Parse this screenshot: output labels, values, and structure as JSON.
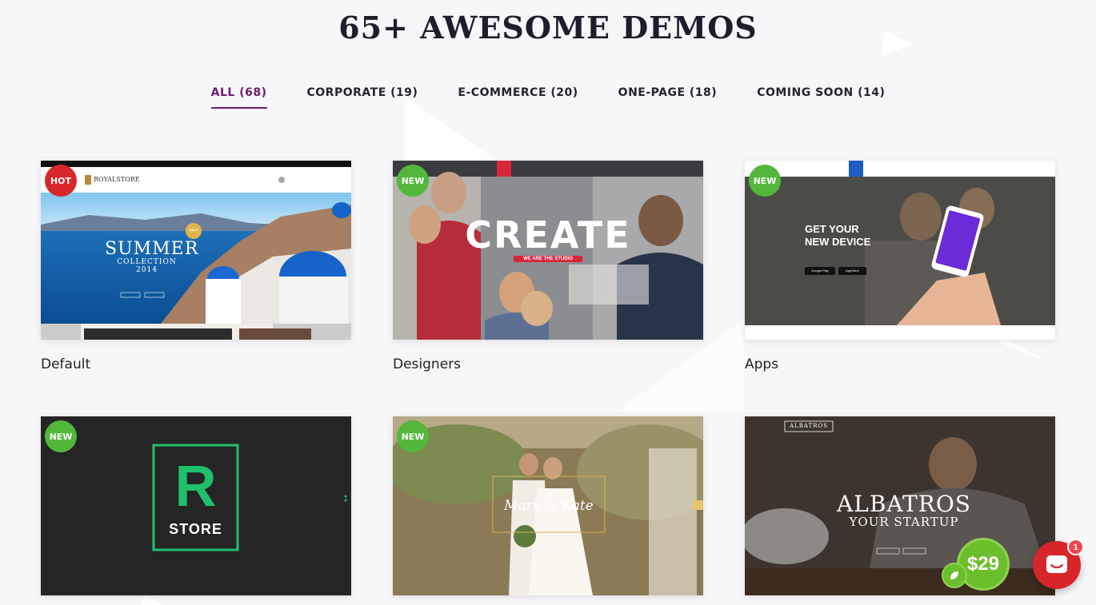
{
  "header": {
    "title": "65+ AWESOME DEMOS"
  },
  "filters": [
    {
      "label": "ALL (68)",
      "active": true
    },
    {
      "label": "CORPORATE (19)",
      "active": false
    },
    {
      "label": "E-COMMERCE (20)",
      "active": false
    },
    {
      "label": "ONE-PAGE (18)",
      "active": false
    },
    {
      "label": "COMING SOON (14)",
      "active": false
    }
  ],
  "demos": [
    {
      "title": "Default",
      "badge": "HOT",
      "thumb": {
        "logo": "ROYALSTORE",
        "headline": "SUMMER",
        "subline": "COLLECTION 2014",
        "sale": "SALE"
      }
    },
    {
      "title": "Designers",
      "badge": "NEW",
      "thumb": {
        "headline": "CREATE",
        "subline": "WE ARE THE STUDIO"
      }
    },
    {
      "title": "Apps",
      "badge": "NEW",
      "thumb": {
        "headline": "GET YOUR",
        "headline2": "NEW DEVICE",
        "store1": "Google Play",
        "store2": "AppStore"
      }
    },
    {
      "title": "",
      "badge": "NEW",
      "thumb": {
        "logo_letter": "R",
        "logo_word": "STORE"
      }
    },
    {
      "title": "",
      "badge": "NEW",
      "thumb": {
        "headline": "Mark & Kate"
      }
    },
    {
      "title": "",
      "badge": "",
      "thumb": {
        "logo": "ALBATROS",
        "headline": "ALBATROS",
        "subline": "YOUR STARTUP",
        "price": "$29"
      }
    }
  ],
  "chat": {
    "unread": "1"
  },
  "colors": {
    "accent": "#6d1a72",
    "hot": "#d9262a",
    "new": "#53b73c",
    "chat": "#d7262b"
  }
}
